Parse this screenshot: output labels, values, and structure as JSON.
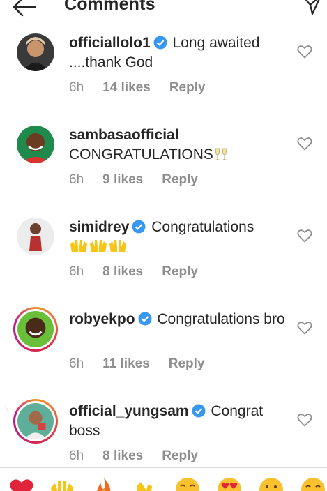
{
  "header": {
    "title": "Comments"
  },
  "comments": [
    {
      "username": "officiallolo1",
      "verified": true,
      "text": "Long awaited ....thank God",
      "time": "6h",
      "likes": "14 likes",
      "reply": "Reply"
    },
    {
      "username": "sambasaofficial",
      "verified": false,
      "text": "CONGRATULATIONS",
      "emoji": "champagne-glasses",
      "time": "6h",
      "likes": "9 likes",
      "reply": "Reply"
    },
    {
      "username": "simidrey",
      "verified": true,
      "text": "Congratulations",
      "emoji": "raising-hands x3",
      "time": "6h",
      "likes": "8 likes",
      "reply": "Reply"
    },
    {
      "username": "robyekpo",
      "verified": true,
      "text": "Congratulations bro",
      "time": "6h",
      "likes": "11 likes",
      "reply": "Reply"
    },
    {
      "username": "official_yungsam",
      "verified": true,
      "text": "Congrat boss",
      "time": "6h",
      "likes": "8 likes",
      "reply": "Reply"
    }
  ],
  "reactions": [
    "red-heart",
    "raising-hands",
    "fire",
    "clapping-hands",
    "crying-laughing-face",
    "heart-eyes-face",
    "astonished-face",
    "crying-face"
  ],
  "colors": {
    "verified": "#3897f0",
    "meta": "#8e8e8e",
    "text": "#262626",
    "divider": "#dbdbdb"
  }
}
